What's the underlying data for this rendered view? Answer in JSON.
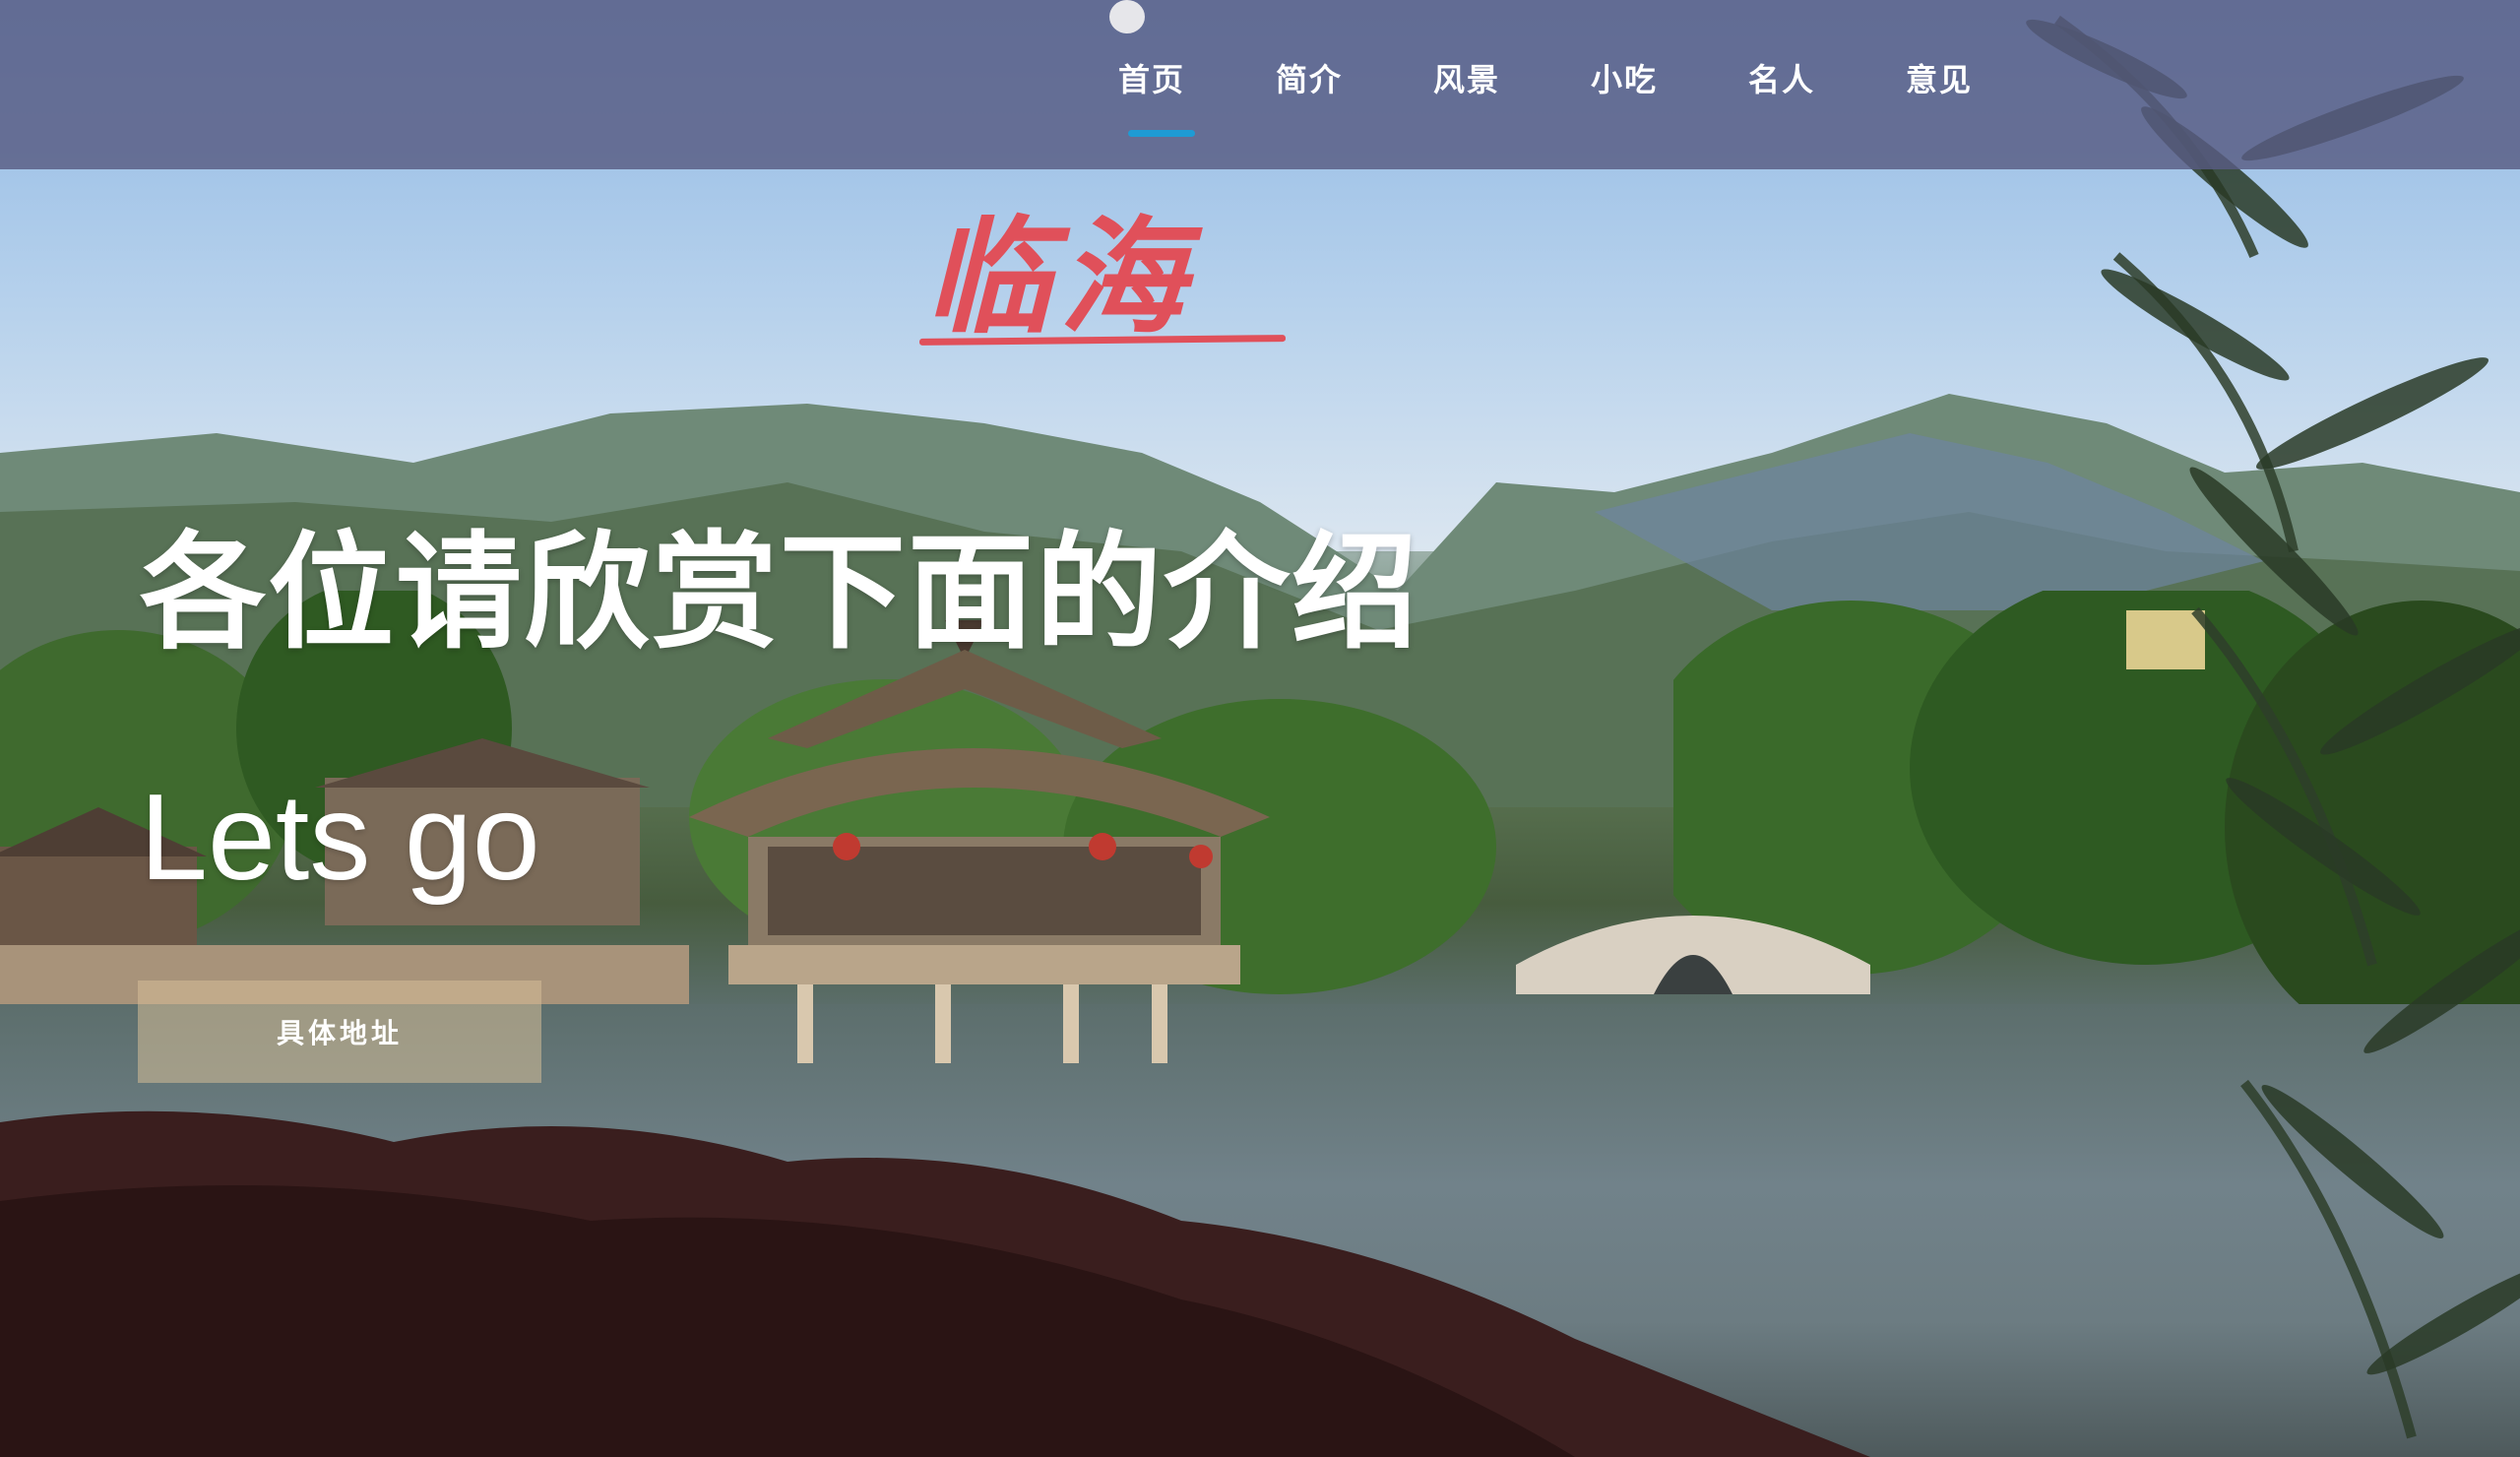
{
  "nav": {
    "items": [
      {
        "label": "首页",
        "active": true
      },
      {
        "label": "简介",
        "active": false
      },
      {
        "label": "风景",
        "active": false
      },
      {
        "label": "小吃",
        "active": false
      },
      {
        "label": "名人",
        "active": false
      },
      {
        "label": "意见",
        "active": false
      }
    ],
    "active_indicator_color": "#1e9bd4",
    "header_color": "#585c82"
  },
  "logo": {
    "text": "临海",
    "color": "#e0505a"
  },
  "hero": {
    "title": "各位请欣赏下面的介绍",
    "subtitle": "Lets go",
    "button_label": "具体地址"
  },
  "background": {
    "icon": "landscape-lake-pavilion-image"
  }
}
